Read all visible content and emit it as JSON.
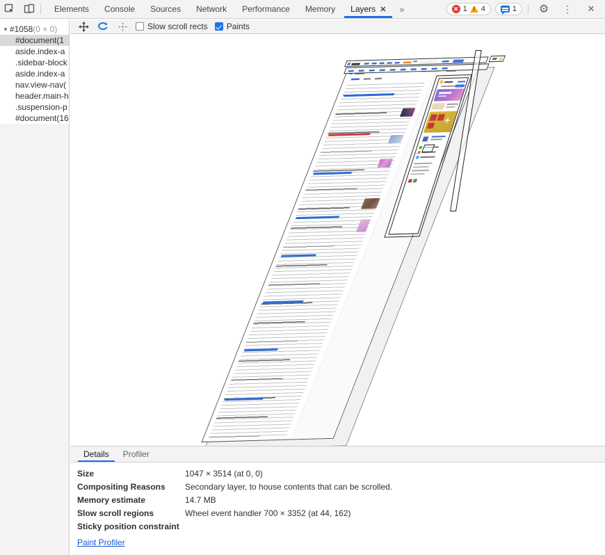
{
  "devtools": {
    "tabs": [
      "Elements",
      "Console",
      "Sources",
      "Network",
      "Performance",
      "Memory",
      "Layers"
    ],
    "active_tab": "Layers",
    "layers_tab_close": "✕",
    "overflow_chevron": "»",
    "badges": {
      "errors": "1",
      "warnings": "4",
      "issues": "1"
    },
    "icons": {
      "gear": "⚙",
      "kebab": "⋮",
      "close": "✕"
    },
    "colors": {
      "accent_blue": "#1a73e8",
      "error_red": "#df3434",
      "warning_yellow": "#f0a800",
      "link_blue": "#1558d6"
    }
  },
  "layer_tree": {
    "root_label": "#1058",
    "root_dims": "(0 × 0)",
    "root_arrow": "▼",
    "items": [
      {
        "label": "#document(1",
        "selected": true
      },
      {
        "label": "aside.index-a",
        "selected": false
      },
      {
        "label": ".sidebar-block",
        "selected": false
      },
      {
        "label": "aside.index-a",
        "selected": false
      },
      {
        "label": "nav.view-nav(",
        "selected": false
      },
      {
        "label": "header.main-h",
        "selected": false
      },
      {
        "label": ".suspension-p",
        "selected": false
      },
      {
        "label": "#document(16",
        "selected": false
      }
    ]
  },
  "layers_toolbar": {
    "slow_scroll_label": "Slow scroll rects",
    "paints_label": "Paints",
    "slow_scroll_checked": false,
    "paints_checked": true
  },
  "details_pane": {
    "tabs": [
      "Details",
      "Profiler"
    ],
    "active_tab": "Details",
    "rows": [
      {
        "label": "Size",
        "value": "1047 × 3514 (at 0, 0)"
      },
      {
        "label": "Compositing Reasons",
        "value": "Secondary layer, to house contents that can be scrolled."
      },
      {
        "label": "Memory estimate",
        "value": "14.7 MB"
      },
      {
        "label": "Slow scroll regions",
        "value": "Wheel event handler 700 × 3352 (at 44, 162)"
      },
      {
        "label": "Sticky position constraint",
        "value": ""
      }
    ],
    "link_label": "Paint Profiler"
  }
}
